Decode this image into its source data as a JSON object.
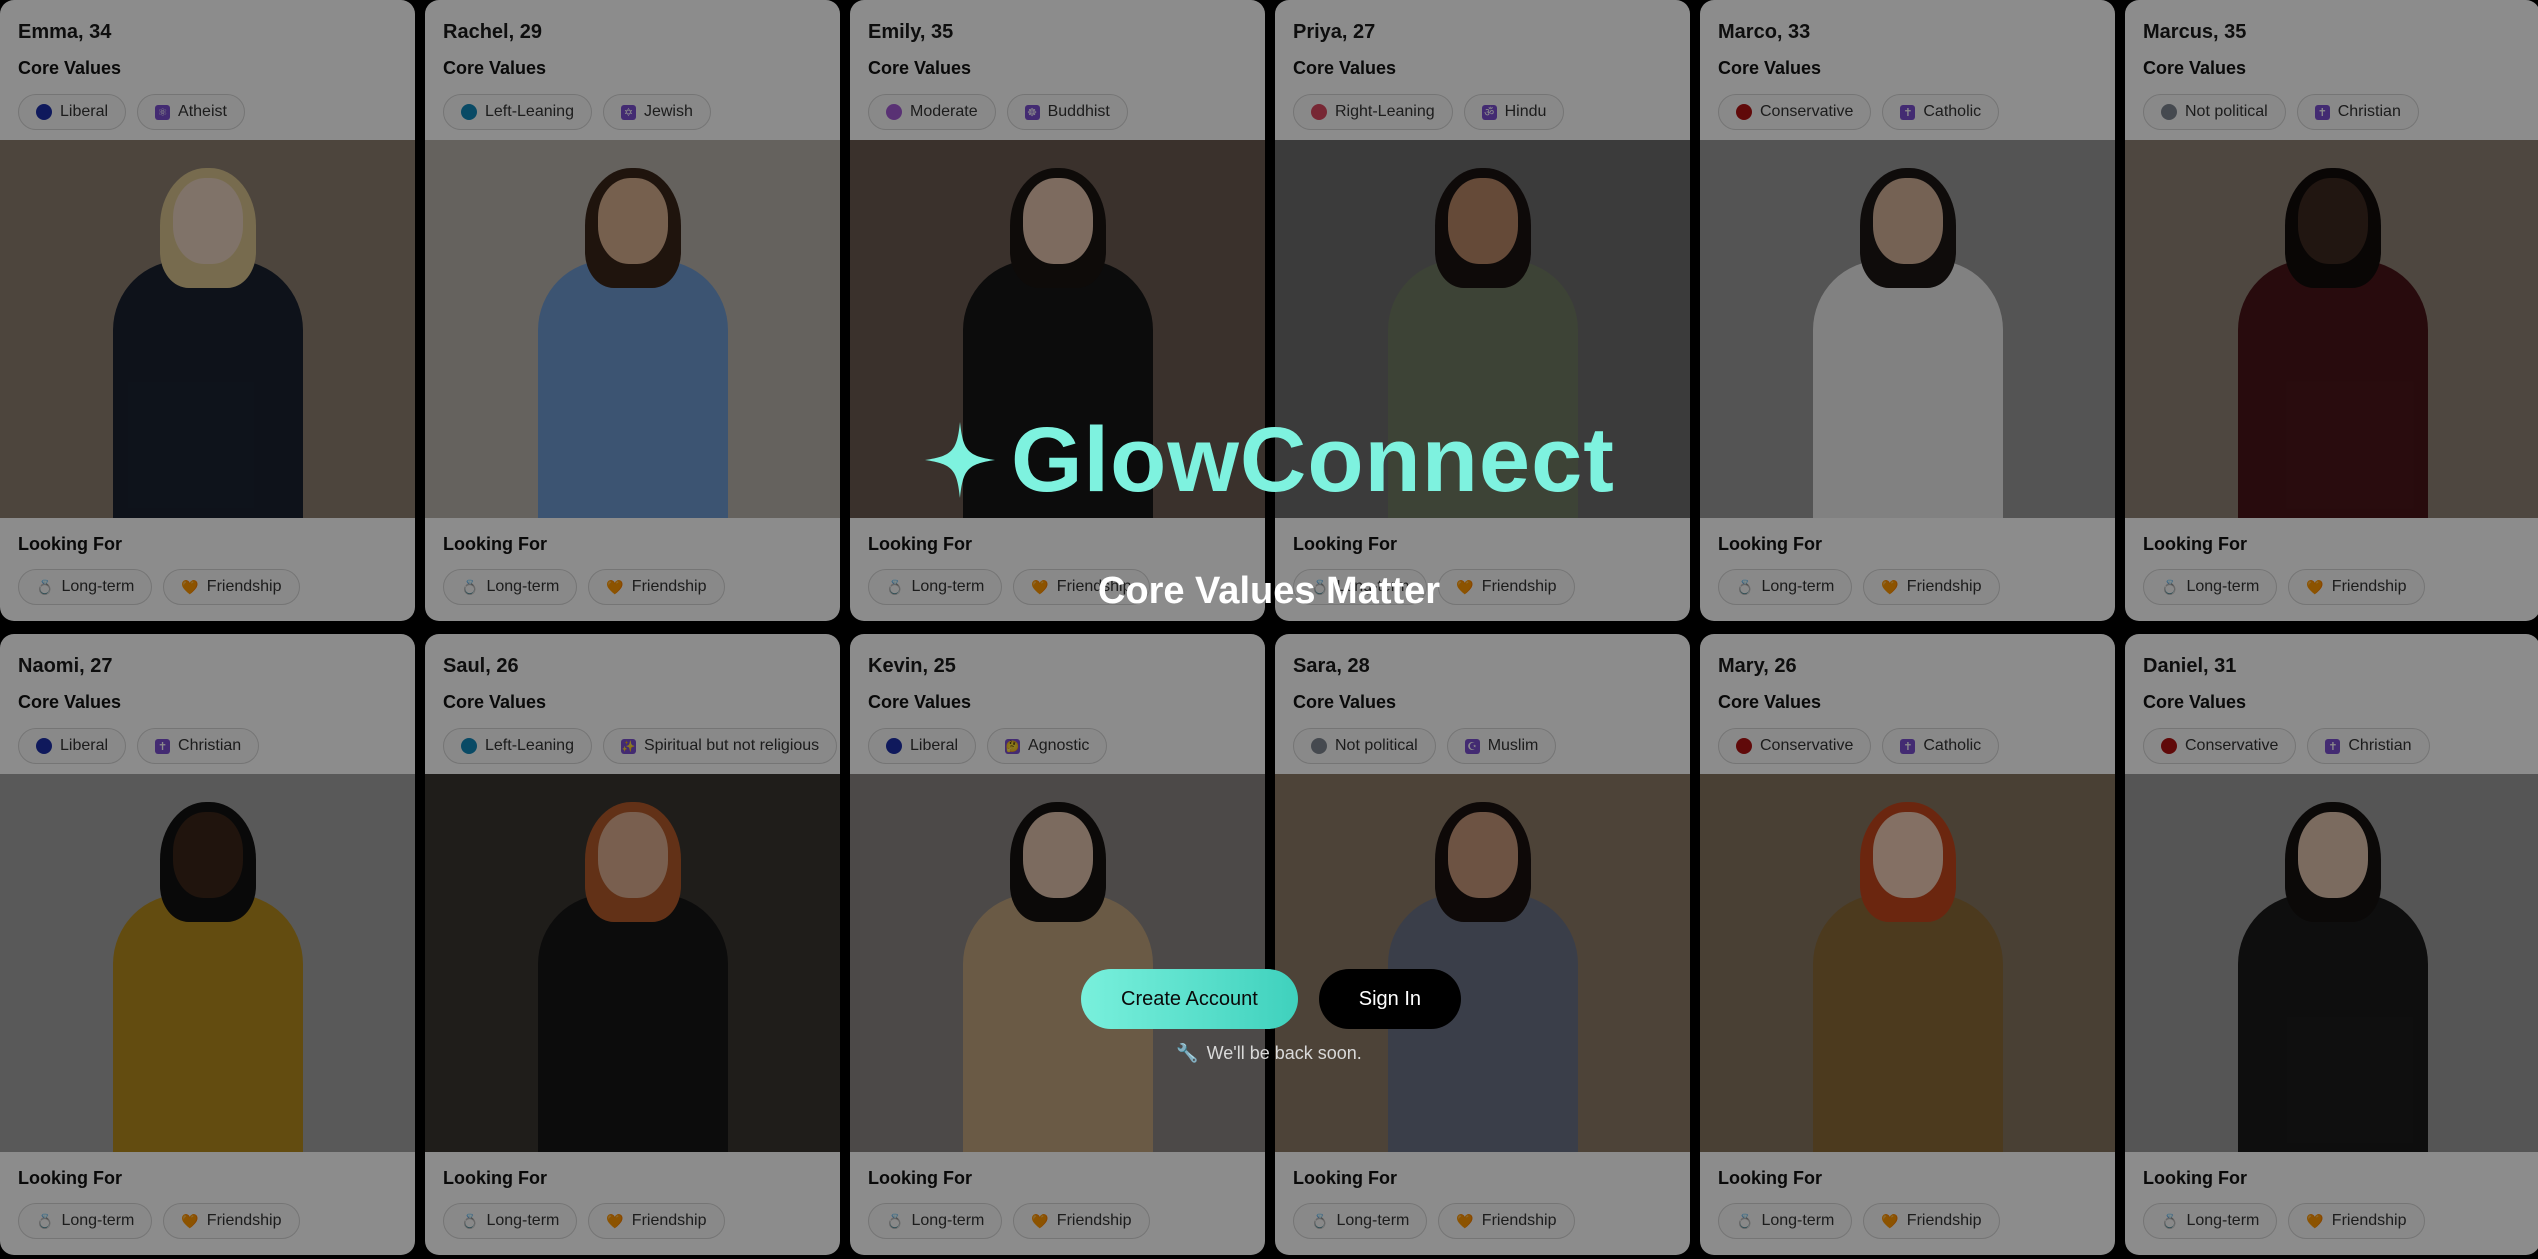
{
  "labels": {
    "core_values": "Core Values",
    "looking_for": "Looking For"
  },
  "profiles": [
    {
      "name": "Emma, 34",
      "politics": {
        "label": "Liberal",
        "color": "#1c2fa8"
      },
      "religion": {
        "label": "Atheist",
        "icon": "atheist-icon",
        "symbol": "⚛"
      },
      "looking": [
        {
          "label": "Long-term",
          "icon": "ring-icon"
        },
        {
          "label": "Friendship",
          "icon": "heart-icon"
        }
      ],
      "photo": {
        "bg": "#8d7f70",
        "hair": "#d9c48e",
        "skin": "#e9d2bf",
        "outfit": "#1a2231"
      }
    },
    {
      "name": "Rachel, 29",
      "politics": {
        "label": "Left-Leaning",
        "color": "#1287b8"
      },
      "religion": {
        "label": "Jewish",
        "icon": "star-of-david-icon",
        "symbol": "✡"
      },
      "looking": [
        {
          "label": "Long-term",
          "icon": "ring-icon"
        },
        {
          "label": "Friendship",
          "icon": "heart-icon"
        }
      ],
      "photo": {
        "bg": "#b9b3ab",
        "hair": "#3a2519",
        "skin": "#d8b08f",
        "outfit": "#6e9ad0"
      }
    },
    {
      "name": "Emily, 35",
      "politics": {
        "label": "Moderate",
        "color": "#a35ad4"
      },
      "religion": {
        "label": "Buddhist",
        "icon": "dharma-wheel-icon",
        "symbol": "☸"
      },
      "looking": [
        {
          "label": "Long-term",
          "icon": "ring-icon"
        },
        {
          "label": "Friendship",
          "icon": "heart-icon"
        }
      ],
      "photo": {
        "bg": "#6b5a50",
        "hair": "#1a1412",
        "skin": "#e3c3ad",
        "outfit": "#161616"
      }
    },
    {
      "name": "Priya, 27",
      "politics": {
        "label": "Right-Leaning",
        "color": "#d9485f"
      },
      "religion": {
        "label": "Hindu",
        "icon": "om-icon",
        "symbol": "ॐ"
      },
      "looking": [
        {
          "label": "Long-term",
          "icon": "ring-icon"
        },
        {
          "label": "Friendship",
          "icon": "heart-icon"
        }
      ],
      "photo": {
        "bg": "#6c6c6c",
        "hair": "#1b1311",
        "skin": "#b98767",
        "outfit": "#6f7b63"
      }
    },
    {
      "name": "Marco, 33",
      "politics": {
        "label": "Conservative",
        "color": "#b01212"
      },
      "religion": {
        "label": "Catholic",
        "icon": "cross-icon",
        "symbol": "✝"
      },
      "looking": [
        {
          "label": "Long-term",
          "icon": "ring-icon"
        },
        {
          "label": "Friendship",
          "icon": "heart-icon"
        }
      ],
      "photo": {
        "bg": "#9a9a9a",
        "hair": "#1c1715",
        "skin": "#d5b29a",
        "outfit": "#ececec"
      }
    },
    {
      "name": "Marcus, 35",
      "politics": {
        "label": "Not political",
        "color": "#7f8690"
      },
      "religion": {
        "label": "Christian",
        "icon": "cross-icon",
        "symbol": "✝"
      },
      "looking": [
        {
          "label": "Long-term",
          "icon": "ring-icon"
        },
        {
          "label": "Friendship",
          "icon": "heart-icon"
        }
      ],
      "photo": {
        "bg": "#8e8275",
        "hair": "#120c0a",
        "skin": "#3d2820",
        "outfit": "#4a1519"
      }
    },
    {
      "name": "Naomi, 27",
      "politics": {
        "label": "Liberal",
        "color": "#1c2fa8"
      },
      "religion": {
        "label": "Christian",
        "icon": "cross-icon",
        "symbol": "✝"
      },
      "looking": [
        {
          "label": "Long-term",
          "icon": "ring-icon"
        },
        {
          "label": "Friendship",
          "icon": "heart-icon"
        }
      ],
      "photo": {
        "bg": "#a3a3a3",
        "hair": "#111",
        "skin": "#3b2619",
        "outfit": "#b58a1e"
      }
    },
    {
      "name": "Saul, 26",
      "politics": {
        "label": "Left-Leaning",
        "color": "#1287b8"
      },
      "religion": {
        "label": "Spiritual but not religious",
        "icon": "sparkle-icon",
        "symbol": "✨"
      },
      "looking": [
        {
          "label": "Long-term",
          "icon": "ring-icon"
        },
        {
          "label": "Friendship",
          "icon": "heart-icon"
        }
      ],
      "photo": {
        "bg": "#3a3530",
        "hair": "#b25a2a",
        "skin": "#dcae91",
        "outfit": "#161616"
      }
    },
    {
      "name": "Kevin, 25",
      "politics": {
        "label": "Liberal",
        "color": "#1c2fa8"
      },
      "religion": {
        "label": "Agnostic",
        "icon": "thinking-icon",
        "symbol": "🤔"
      },
      "looking": [
        {
          "label": "Long-term",
          "icon": "ring-icon"
        },
        {
          "label": "Friendship",
          "icon": "heart-icon"
        }
      ],
      "photo": {
        "bg": "#8a8683",
        "hair": "#151210",
        "skin": "#e2c4ae",
        "outfit": "#c2a47e"
      }
    },
    {
      "name": "Sara, 28",
      "politics": {
        "label": "Not political",
        "color": "#7f8690"
      },
      "religion": {
        "label": "Muslim",
        "icon": "crescent-icon",
        "symbol": "☪"
      },
      "looking": [
        {
          "label": "Long-term",
          "icon": "ring-icon"
        },
        {
          "label": "Friendship",
          "icon": "heart-icon"
        }
      ],
      "photo": {
        "bg": "#8c7a67",
        "hair": "#1a1210",
        "skin": "#c6977a",
        "outfit": "#6b7286"
      }
    },
    {
      "name": "Mary, 26",
      "politics": {
        "label": "Conservative",
        "color": "#b01212"
      },
      "religion": {
        "label": "Catholic",
        "icon": "cross-icon",
        "symbol": "✝"
      },
      "looking": [
        {
          "label": "Long-term",
          "icon": "ring-icon"
        },
        {
          "label": "Friendship",
          "icon": "heart-icon"
        }
      ],
      "photo": {
        "bg": "#857660",
        "hair": "#c4461d",
        "skin": "#f0cdb6",
        "outfit": "#8a6a38"
      }
    },
    {
      "name": "Daniel, 31",
      "politics": {
        "label": "Conservative",
        "color": "#b01212"
      },
      "religion": {
        "label": "Christian",
        "icon": "cross-icon",
        "symbol": "✝"
      },
      "looking": [
        {
          "label": "Long-term",
          "icon": "ring-icon"
        },
        {
          "label": "Friendship",
          "icon": "heart-icon"
        }
      ],
      "photo": {
        "bg": "#9c9c9c",
        "hair": "#141110",
        "skin": "#e1c3ad",
        "outfit": "#1b1b1b"
      }
    }
  ],
  "brand": {
    "name": "GlowConnect",
    "logo_icon": "sparkle-star-icon",
    "accent": "#7ef2df"
  },
  "tagline": "Core Values Matter",
  "actions": {
    "create_account": "Create Account",
    "sign_in": "Sign In"
  },
  "notice": {
    "icon": "wrench-icon",
    "text": "We'll be back soon."
  }
}
